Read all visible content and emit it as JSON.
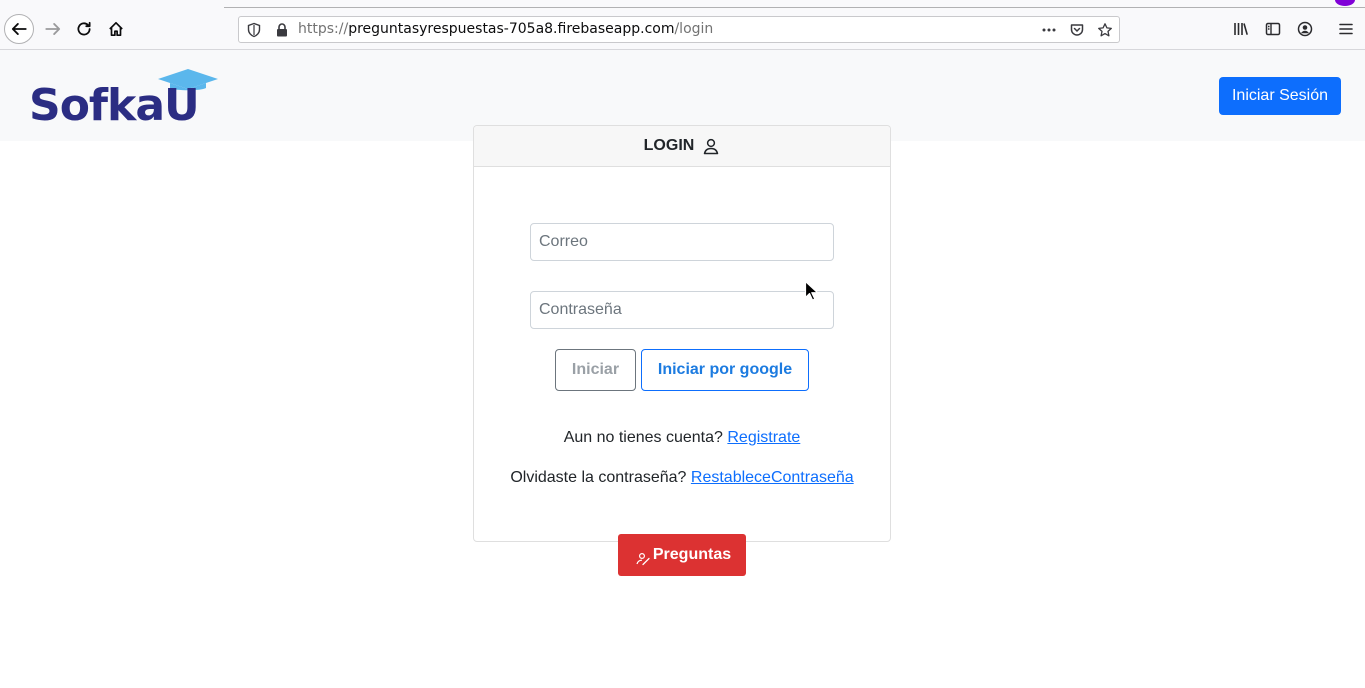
{
  "browser": {
    "url_prefix": "https://",
    "url_host": "preguntasyrespuestas-705a8.firebaseapp.com",
    "url_path": "/login",
    "icons": [
      "back-icon",
      "forward-icon",
      "reload-icon",
      "home-icon",
      "shield-icon",
      "lock-icon",
      "more-icon",
      "pocket-icon",
      "star-icon",
      "library-icon",
      "sidebar-icon",
      "account-icon",
      "menu-icon"
    ]
  },
  "navbar": {
    "logo_text": "SofkaU",
    "login_button": "Iniciar Sesión",
    "colors": {
      "brand": "#2b2d83",
      "cap": "#5bb7ec",
      "primary": "#0d6efd"
    }
  },
  "card": {
    "title": "LOGIN",
    "email_placeholder": "Correo",
    "password_placeholder": "Contraseña",
    "login_button": "Iniciar",
    "google_button": "Iniciar por google",
    "no_account_text": "Aun no tienes cuenta?",
    "register_link": "Registrate",
    "forgot_text": "Olvidaste la contraseña?",
    "reset_link": "RestableceContraseña"
  },
  "questions_button": {
    "label": "Preguntas",
    "color": "#dc3232"
  }
}
